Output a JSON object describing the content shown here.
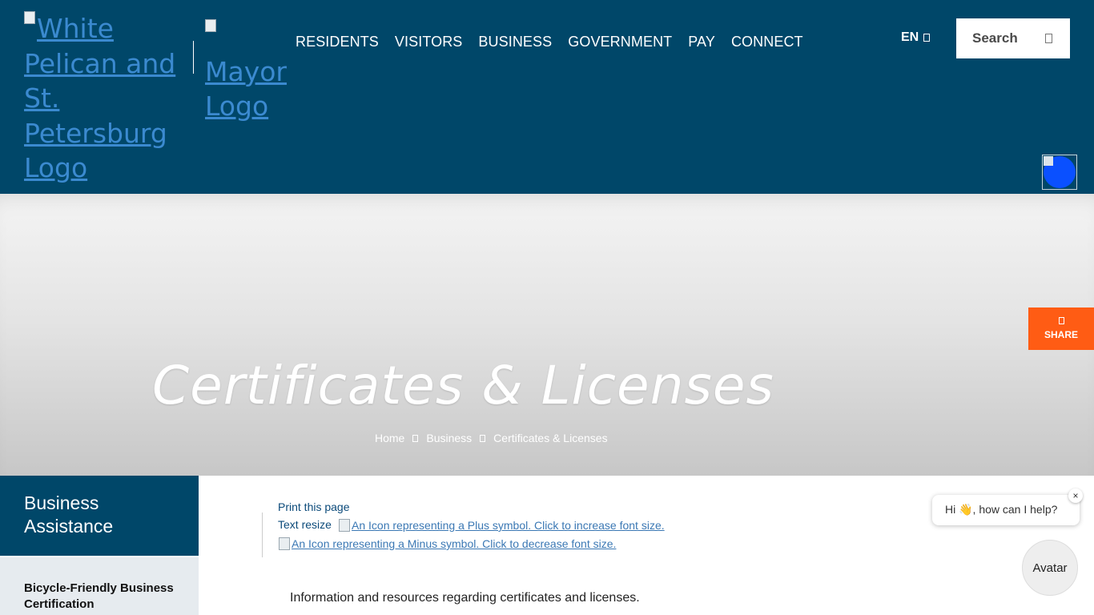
{
  "header": {
    "logo_alt": "White Pelican and St. Petersburg Logo",
    "mayor_alt": "Mayor Logo",
    "nav": [
      "RESIDENTS",
      "VISITORS",
      "BUSINESS",
      "GOVERNMENT",
      "PAY",
      "CONNECT"
    ],
    "language": "EN",
    "search_label": "Search"
  },
  "hero": {
    "title": "Certificates & Licenses",
    "breadcrumb": [
      "Home",
      "Business",
      "Certificates & Licenses"
    ]
  },
  "share_label": "SHARE",
  "sidebar": {
    "title": "Business Assistance",
    "items": [
      "Bicycle-Friendly Business Certification"
    ]
  },
  "content": {
    "print_label": "Print this page",
    "resize_label": "Text resize",
    "plus_alt": "An Icon representing a Plus symbol. Click to increase font size.",
    "minus_alt": "An Icon representing a Minus symbol. Click to decrease font size.",
    "intro": "Information and resources regarding certificates and licenses."
  },
  "chat": {
    "greeting": "Hi 👋, how can I help?",
    "close": "×",
    "avatar_label": "Avatar"
  },
  "colors": {
    "header_bg": "#004769",
    "share_bg": "#ff5c14",
    "accessibility_dot": "#0a50ff"
  }
}
